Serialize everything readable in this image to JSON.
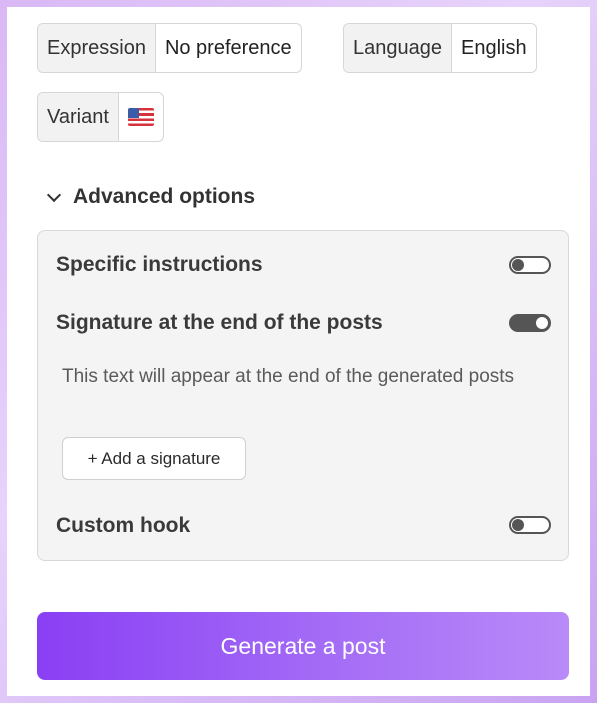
{
  "selectors": {
    "expression": {
      "label": "Expression",
      "value": "No preference"
    },
    "language": {
      "label": "Language",
      "value": "English"
    },
    "variant": {
      "label": "Variant",
      "value_icon": "us-flag-icon"
    }
  },
  "advanced": {
    "title": "Advanced options",
    "expanded": true,
    "options": {
      "specific_instructions": {
        "label": "Specific instructions",
        "enabled": false
      },
      "signature": {
        "label": "Signature at the end of the posts",
        "enabled": true,
        "help": "This text will appear at the end of the generated posts",
        "add_button": "+ Add a signature"
      },
      "custom_hook": {
        "label": "Custom hook",
        "enabled": false
      }
    }
  },
  "actions": {
    "generate_label": "Generate a post",
    "generate_gradient": [
      "#8a3ff4",
      "#b98af8"
    ]
  }
}
